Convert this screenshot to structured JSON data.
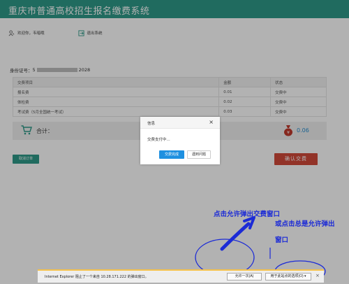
{
  "header": {
    "title": "重庆市普通高校招生报名缴费系统"
  },
  "userbar": {
    "welcome": "欢迎你，韦暗哦",
    "logout": "退出系统"
  },
  "student": {
    "id_label": "身份证号：",
    "id_prefix": "5",
    "id_suffix": "2028"
  },
  "fee_table": {
    "headers": [
      "交费项目",
      "金额",
      "状态"
    ],
    "rows": [
      {
        "item": "报名费",
        "amount": "0.01",
        "status": "交费中"
      },
      {
        "item": "体检费",
        "amount": "0.02",
        "status": "交费中"
      },
      {
        "item": "考试费（5月全国统一考试）",
        "amount": "0.03",
        "status": "交费中"
      }
    ]
  },
  "total": {
    "label": "合计：",
    "amount": "0.06"
  },
  "buttons": {
    "cancel": "取消订单",
    "confirm": "确认交费"
  },
  "dialog": {
    "title": "信息",
    "close": "×",
    "message": "交费支付中...",
    "primary": "交费完成",
    "secondary": "遇到问题"
  },
  "annotations": {
    "note1": "点击允许弹出交费窗口",
    "note2": "或点击总是允许弹出",
    "note3": "窗口"
  },
  "ie_bar": {
    "message": "Internet Explorer 阻止了一个来自 10.28.171.222 的弹出窗口。",
    "allow_once": "允许一次(A)",
    "options": "用于此站点的选项(O) ▾",
    "close": "×"
  },
  "colors": {
    "header": "#2e9a88",
    "confirm": "#d24a3a",
    "primary_blue": "#1e90e0",
    "annotation": "#1c2bd6"
  },
  "icons": [
    "user-icon",
    "logout-icon",
    "cart-icon",
    "money-bag-icon",
    "close-icon"
  ]
}
